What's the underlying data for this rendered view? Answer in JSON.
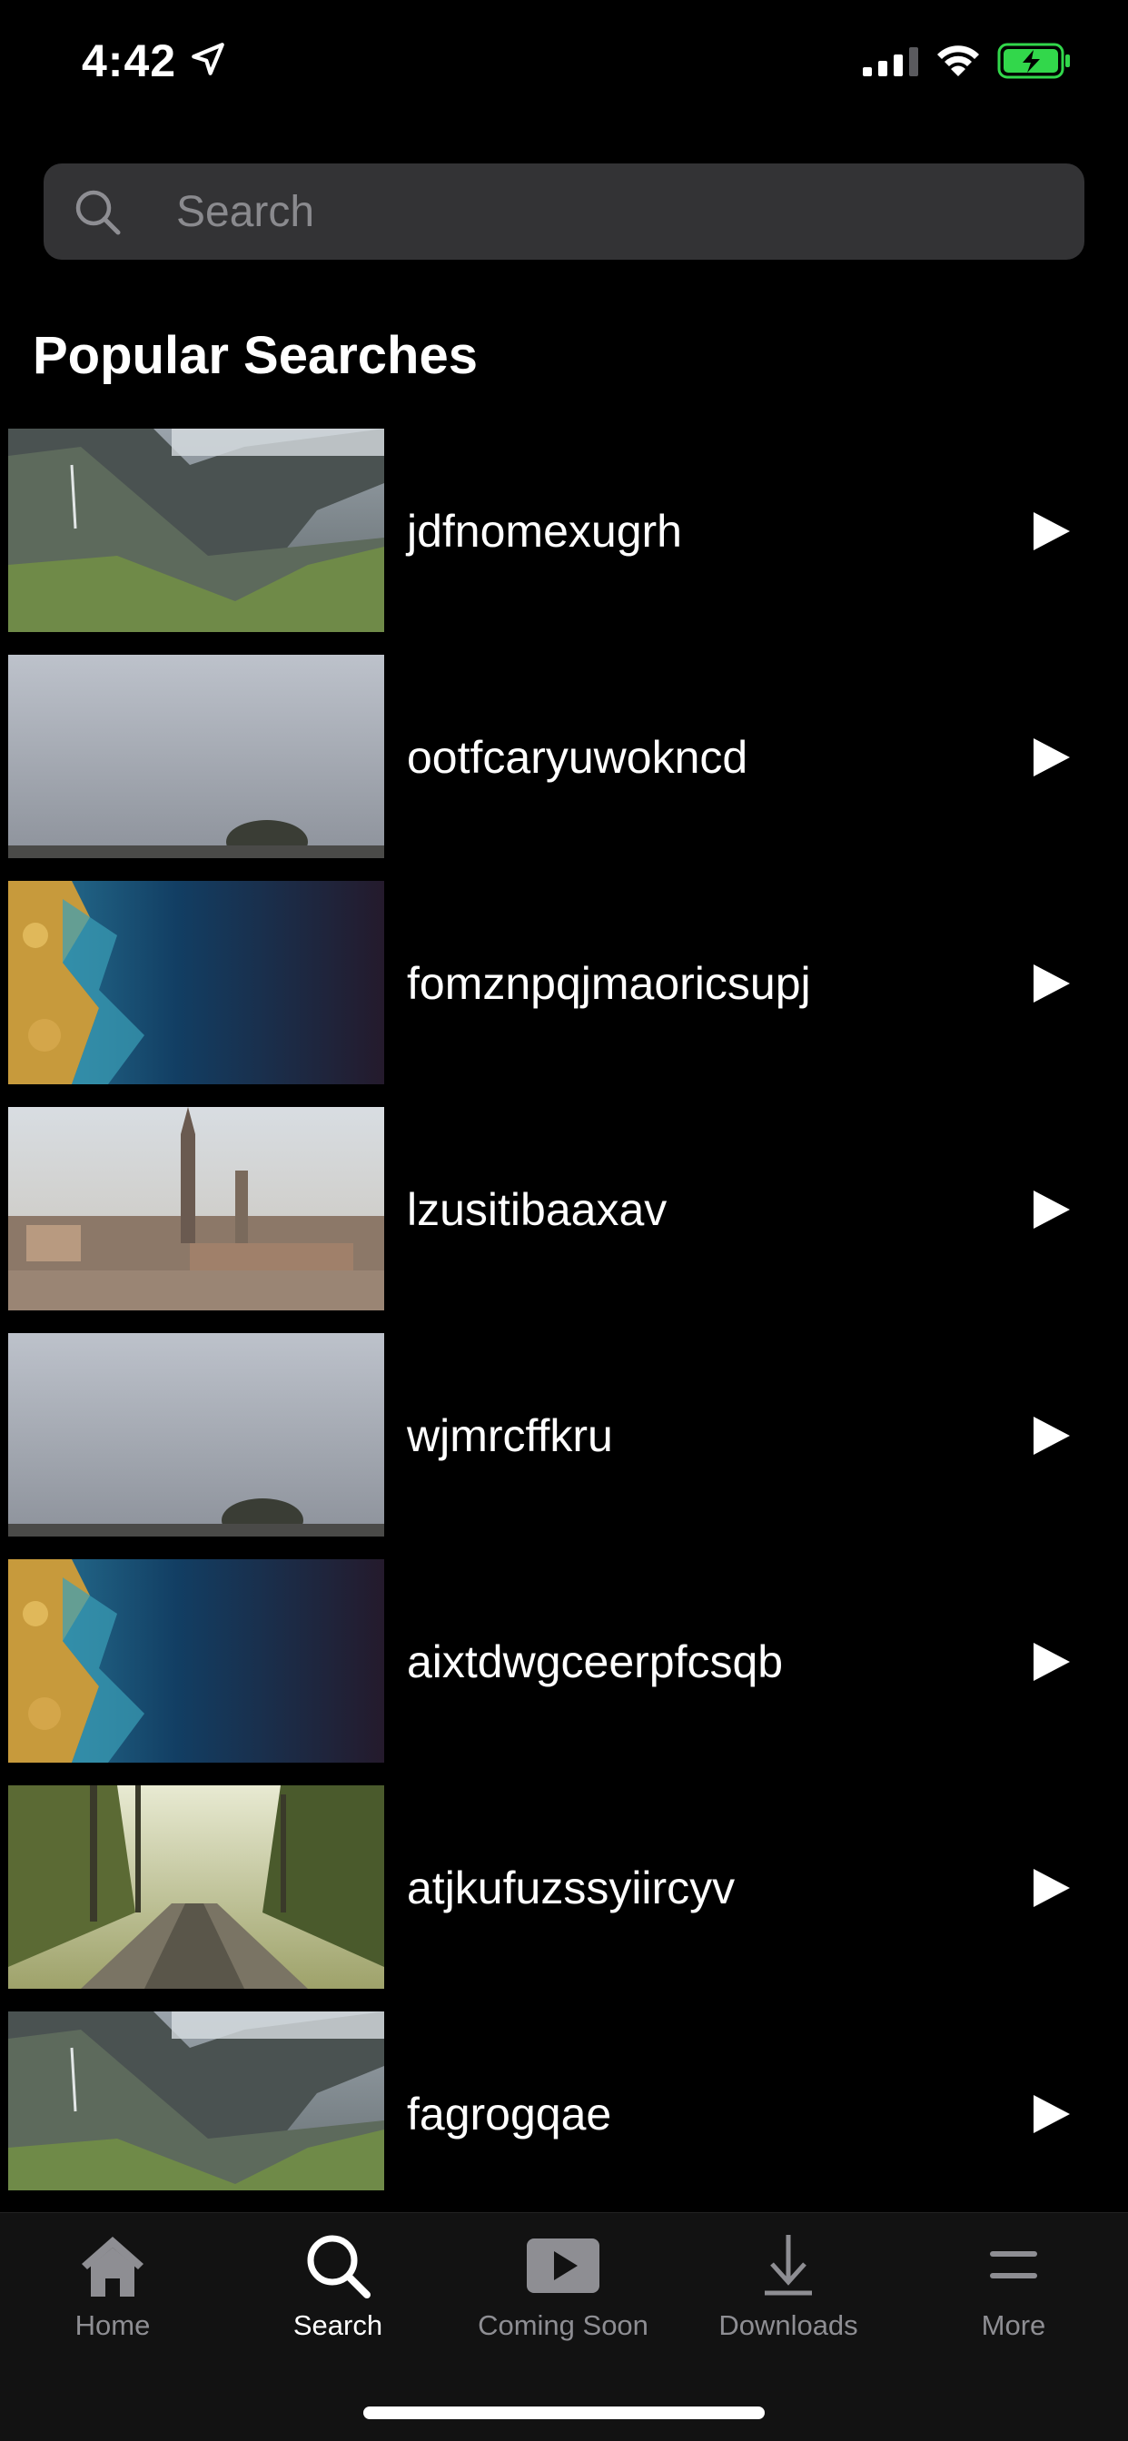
{
  "status_bar": {
    "time": "4:42",
    "icons": [
      "location-arrow-icon",
      "cellular-signal-icon",
      "wifi-icon",
      "battery-charging-icon"
    ],
    "battery_color": "#32d74b"
  },
  "search": {
    "placeholder": "Search",
    "value": ""
  },
  "section": {
    "title": "Popular Searches"
  },
  "items": [
    {
      "title": "jdfnomexugrh",
      "thumbnail": "mountain-valley"
    },
    {
      "title": "ootfcaryuwokncd",
      "thumbnail": "foggy-rock"
    },
    {
      "title": "fomznpqjmaoricsupj",
      "thumbnail": "aerial-coast"
    },
    {
      "title": "lzusitibaaxav",
      "thumbnail": "city-skyline"
    },
    {
      "title": "wjmrcffkru",
      "thumbnail": "foggy-rock"
    },
    {
      "title": "aixtdwgceerpfcsqb",
      "thumbnail": "aerial-coast"
    },
    {
      "title": "atjkufuzssyiircyv",
      "thumbnail": "forest-railway"
    },
    {
      "title": "fagrogqae",
      "thumbnail": "mountain-valley"
    }
  ],
  "tabs": [
    {
      "label": "Home",
      "icon": "home-icon",
      "active": false
    },
    {
      "label": "Search",
      "icon": "search-icon",
      "active": true
    },
    {
      "label": "Coming Soon",
      "icon": "play-rectangle-icon",
      "active": false
    },
    {
      "label": "Downloads",
      "icon": "download-icon",
      "active": false
    },
    {
      "label": "More",
      "icon": "menu-icon",
      "active": false
    }
  ],
  "colors": {
    "background": "#000000",
    "search_field": "#333335",
    "tab_inactive": "#8e8e93",
    "tab_active": "#ffffff"
  }
}
